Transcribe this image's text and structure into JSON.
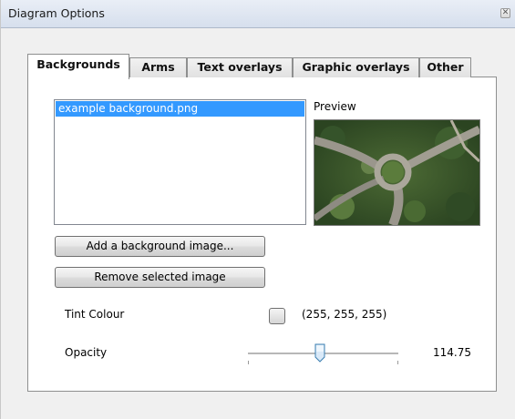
{
  "window": {
    "title": "Diagram Options",
    "close_glyph": "✕"
  },
  "tabs": [
    {
      "label": "Backgrounds",
      "active": true
    },
    {
      "label": "Arms",
      "active": false
    },
    {
      "label": "Text overlays",
      "active": false
    },
    {
      "label": "Graphic overlays",
      "active": false
    },
    {
      "label": "Other",
      "active": false
    }
  ],
  "backgrounds": {
    "images": [
      "example background.png"
    ],
    "selected_index": 0,
    "preview_label": "Preview",
    "add_button": "Add a background image...",
    "remove_button": "Remove selected image"
  },
  "tint": {
    "label": "Tint Colour",
    "value": "(255, 255, 255)",
    "color": "#ffffff"
  },
  "opacity": {
    "label": "Opacity",
    "value": "114.75",
    "min": 0,
    "max": 255,
    "level": 114.75
  },
  "colors": {
    "selection": "#3399ff",
    "panel_border": "#8e8f8f",
    "window_bg": "#f0f0f0"
  }
}
